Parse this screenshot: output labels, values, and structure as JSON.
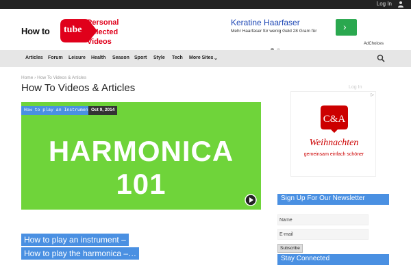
{
  "topbar": {
    "login_label": "Log In"
  },
  "logo": {
    "howto": "How to",
    "tube": "tube",
    "tagline": "Personal Selected Videos"
  },
  "ad_banner": {
    "title": "Keratine Haarfaser",
    "text": "Mehr Haarfaser für wenig Geld 28 Gram für",
    "adchoices": "AdChoices"
  },
  "nav": {
    "items": [
      "Articles",
      "Forum",
      "Leisure",
      "Health",
      "Season",
      "Sport",
      "Style",
      "Tech",
      "More Sites"
    ]
  },
  "breadcrumb": {
    "home": "Home",
    "current": "How To Videos & Articles"
  },
  "page_title": "How To Videos & Articles",
  "login_faint": "Log In",
  "feature": {
    "category": "How to play an Instrument",
    "date": "Oct 9, 2014",
    "image_text": "HARMONICA 101"
  },
  "caption": {
    "line1": "How to play an instrument –",
    "line2": "How to play the harmonica –…"
  },
  "side_ad": {
    "logo": "C&A",
    "headline": "Weihnachten",
    "subline": "gemeinsam einfach schöner"
  },
  "newsletter": {
    "title": "Sign Up For Our Newsletter",
    "name_placeholder": "Name",
    "email_placeholder": "E-mail",
    "subscribe_label": "Subscribe"
  },
  "stay_connected": {
    "title": "Stay Connected"
  },
  "colors": {
    "accent_blue": "#4a90e2",
    "brand_red": "#e0001b",
    "green": "#6fd43a",
    "ad_green": "#2aa84f"
  }
}
